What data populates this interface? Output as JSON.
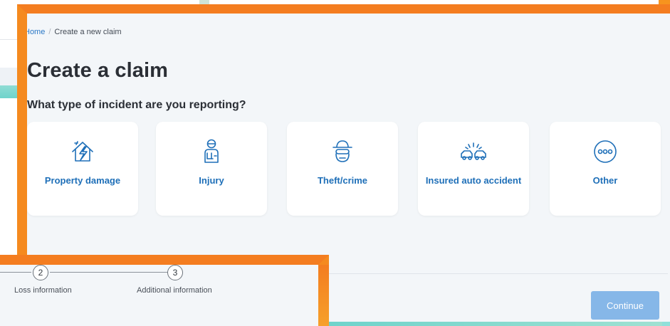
{
  "breadcrumb": {
    "home_label": "Home",
    "separator": "/",
    "current_label": "Create a new claim"
  },
  "page": {
    "title": "Create a claim",
    "question": "What type of incident are you reporting?"
  },
  "incident_types": [
    {
      "label": "Property damage",
      "icon": "house-lightning-icon"
    },
    {
      "label": "Injury",
      "icon": "injured-person-icon"
    },
    {
      "label": "Theft/crime",
      "icon": "masked-thief-icon"
    },
    {
      "label": "Insured auto accident",
      "icon": "car-collision-icon"
    },
    {
      "label": "Other",
      "icon": "ellipsis-circle-icon"
    }
  ],
  "actions": {
    "continue_label": "Continue"
  },
  "progress": {
    "steps": [
      {
        "number": "2",
        "label": "Loss information"
      },
      {
        "number": "3",
        "label": "Additional information"
      }
    ]
  },
  "colors": {
    "accent_orange": "#f47d20",
    "link_blue": "#1e6fb8",
    "continue_button": "#86b7e8",
    "panel_background": "#f3f6f9"
  }
}
